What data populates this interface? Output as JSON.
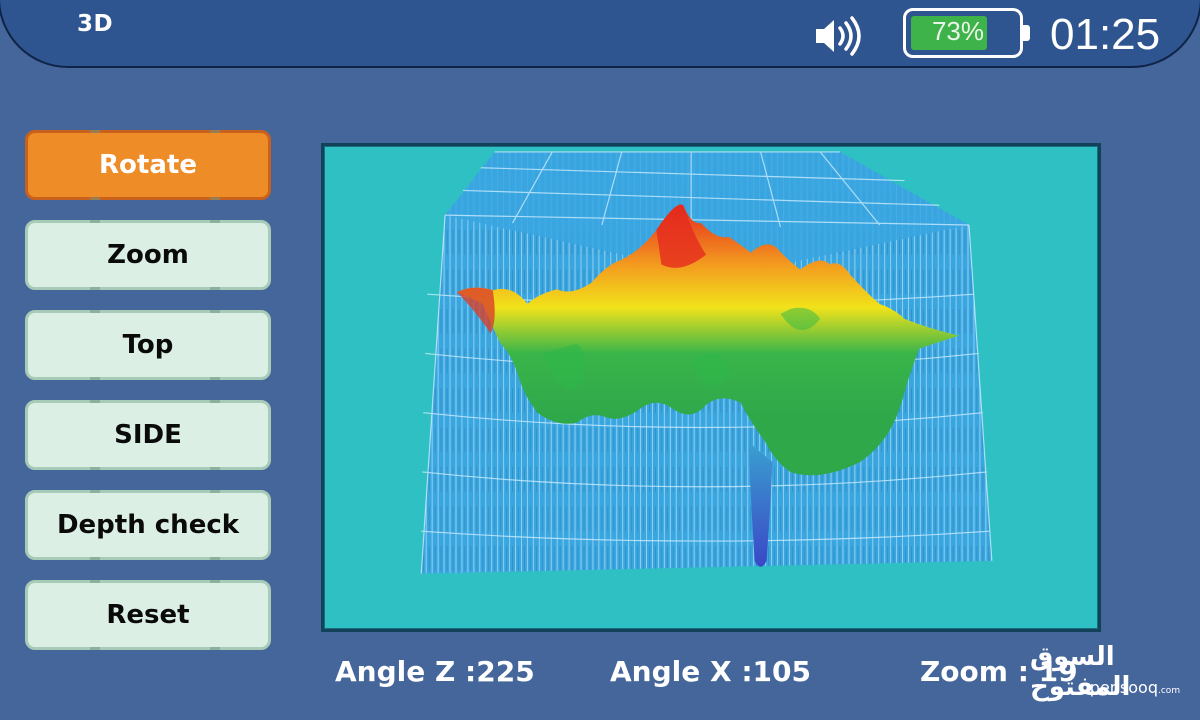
{
  "header": {
    "mode_title": "3D",
    "speaker_icon": "speaker-volume-icon",
    "battery": {
      "percent": 73,
      "label": "73%",
      "fill_color": "#3eb34a"
    },
    "clock": "01:25"
  },
  "sidebar": {
    "buttons": [
      {
        "label": "Rotate",
        "active": true
      },
      {
        "label": "Zoom",
        "active": false
      },
      {
        "label": "Top",
        "active": false
      },
      {
        "label": "SIDE",
        "active": false
      },
      {
        "label": "Depth check",
        "active": false
      },
      {
        "label": "Reset",
        "active": false
      }
    ]
  },
  "plot": {
    "description": "3D ground scan surface plot",
    "background_color": "#2ec0c2",
    "grid_color": "#3aa6e0",
    "colormap": [
      "#3850c8",
      "#2fb84a",
      "#f1e21a",
      "#f39a1f",
      "#e52a1e"
    ]
  },
  "readouts": {
    "angle_z": "Angle Z :225",
    "angle_x": "Angle X :105",
    "zoom": "Zoom : 19"
  },
  "watermark": {
    "arabic": "السوق المفتوح",
    "latin": "opensooq",
    "suffix": ".com"
  },
  "colors": {
    "background": "#45669a",
    "header": "#2f5590",
    "active_button": "#ee8c27",
    "button": "#dcefe4"
  }
}
